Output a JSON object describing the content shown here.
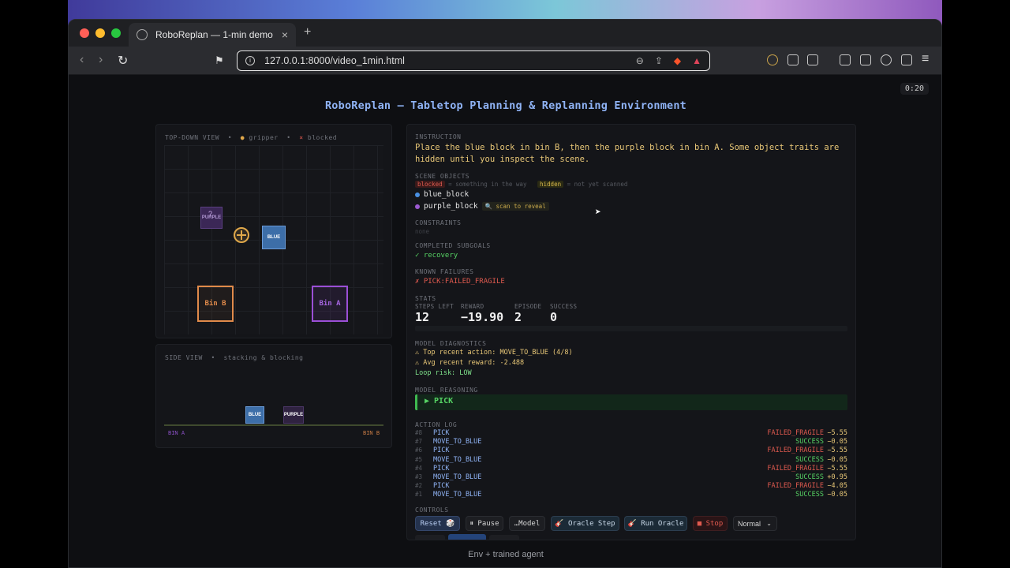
{
  "browser": {
    "tab_title": "RoboReplan — 1-min demo",
    "tab_close": "×",
    "new_tab": "+",
    "url": "127.0.0.1:8000/video_1min.html",
    "timer": "0:20"
  },
  "page": {
    "title": "RoboReplan — Tabletop Planning & Replanning Environment",
    "caption": "Env + trained agent"
  },
  "top_view": {
    "label": "TOP-DOWN VIEW",
    "sep": "•",
    "gripper_label": "gripper",
    "blocked_label": "blocked",
    "purple_cube": "PURPLE",
    "purple_mark": "?",
    "blue_cube": "BLUE",
    "bin_b": "Bin B",
    "bin_a": "Bin A"
  },
  "side_view": {
    "label": "SIDE VIEW",
    "sep": "•",
    "sublabel": "stacking & blocking",
    "blue_cube": "BLUE",
    "purple_cube": "PURPLE",
    "bin_a": "BIN A",
    "bin_b": "BIN B"
  },
  "instruction": {
    "label": "INSTRUCTION",
    "text": "Place the blue block in bin B, then the purple block in bin A. Some object traits are hidden until you inspect the scene."
  },
  "scene": {
    "label": "SCENE OBJECTS",
    "blocked_tag": "blocked",
    "blocked_desc": "= something in the way",
    "hidden_tag": "hidden",
    "hidden_desc": "= not yet scanned",
    "objects": [
      {
        "name": "blue_block",
        "color": "#4a90e2"
      },
      {
        "name": "purple_block",
        "color": "#9b59d0",
        "badge": "scan to reveal"
      }
    ]
  },
  "constraints": {
    "label": "CONSTRAINTS",
    "value": "none"
  },
  "completed": {
    "label": "COMPLETED SUBGOALS",
    "value": "✓ recovery"
  },
  "failures": {
    "label": "KNOWN FAILURES",
    "value": "✗ PICK:FAILED_FRAGILE"
  },
  "stats": {
    "label": "STATS",
    "items": [
      {
        "head": "STEPS LEFT",
        "value": "12"
      },
      {
        "head": "REWARD",
        "value": "−19.90"
      },
      {
        "head": "EPISODE",
        "value": "2"
      },
      {
        "head": "SUCCESS",
        "value": "0"
      }
    ]
  },
  "diagnostics": {
    "label": "MODEL DIAGNOSTICS",
    "line1": "⚠ Top recent action: MOVE_TO_BLUE (4/8)",
    "line2": "⚠ Avg recent reward: -2.488",
    "line3": "Loop risk: LOW"
  },
  "reasoning": {
    "label": "MODEL REASONING",
    "value": "▶ PICK"
  },
  "action_log": {
    "label": "ACTION LOG",
    "rows": [
      {
        "num": "#8",
        "action": "PICK",
        "result": "FAILED_FRAGILE",
        "reward": "−5.55"
      },
      {
        "num": "#7",
        "action": "MOVE_TO_BLUE",
        "result": "SUCCESS",
        "reward": "−0.05"
      },
      {
        "num": "#6",
        "action": "PICK",
        "result": "FAILED_FRAGILE",
        "reward": "−5.55"
      },
      {
        "num": "#5",
        "action": "MOVE_TO_BLUE",
        "result": "SUCCESS",
        "reward": "−0.05"
      },
      {
        "num": "#4",
        "action": "PICK",
        "result": "FAILED_FRAGILE",
        "reward": "−5.55"
      },
      {
        "num": "#3",
        "action": "MOVE_TO_BLUE",
        "result": "SUCCESS",
        "reward": "+0.95"
      },
      {
        "num": "#2",
        "action": "PICK",
        "result": "FAILED_FRAGILE",
        "reward": "−4.05"
      },
      {
        "num": "#1",
        "action": "MOVE_TO_BLUE",
        "result": "SUCCESS",
        "reward": "−0.05"
      }
    ]
  },
  "controls": {
    "label": "CONTROLS",
    "reset": "Reset 🎲",
    "pause": "⏸ Pause",
    "model": "…Model",
    "oracle_step": "🎸 Oracle Step",
    "run_oracle": "🎸 Run Oracle",
    "stop": "■ Stop",
    "speed": "Normal"
  },
  "colors": {
    "accent_blue": "#8fb3f5",
    "fail_red": "#e05a4f",
    "success_green": "#56d364",
    "bin_b": "#e08a4a",
    "bin_a": "#9b4fd6"
  }
}
